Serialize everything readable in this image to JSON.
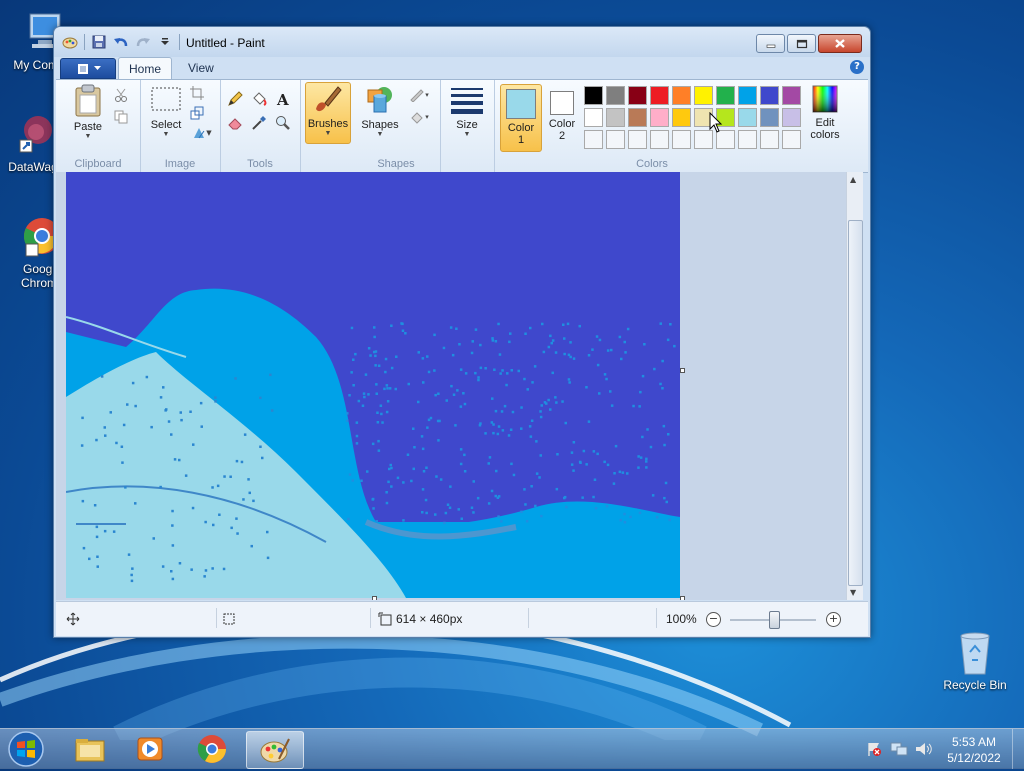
{
  "desktop": {
    "icons": [
      {
        "label": "My Comp",
        "icon": "computer-icon"
      },
      {
        "label": "DataWag",
        "icon": "shortcut-icon"
      },
      {
        "label": "Googl",
        "label2": "Chrom",
        "icon": "chrome-icon"
      },
      {
        "label": "Recycle Bin",
        "icon": "recycle-bin-icon"
      }
    ]
  },
  "window": {
    "title": "Untitled - Paint",
    "tabs": [
      {
        "label": "Home"
      },
      {
        "label": "View"
      }
    ],
    "ribbon": {
      "clipboard": {
        "label": "Clipboard",
        "paste": "Paste"
      },
      "image": {
        "label": "Image",
        "select": "Select"
      },
      "tools": {
        "label": "Tools"
      },
      "brushes": "Brushes",
      "shapes": {
        "label": "Shapes",
        "button": "Shapes"
      },
      "size": "Size",
      "color1": {
        "line1": "Color",
        "line2": "1",
        "value": "#99d9ea"
      },
      "color2": {
        "line1": "Color",
        "line2": "2",
        "value": "#ffffff"
      },
      "colors_label": "Colors",
      "edit_colors": {
        "line1": "Edit",
        "line2": "colors"
      },
      "palette_row1": [
        "#000000",
        "#7f7f7f",
        "#880015",
        "#ed1c24",
        "#ff7f27",
        "#fff200",
        "#22b14c",
        "#00a2e8",
        "#3f48cc",
        "#a349a4"
      ],
      "palette_row2": [
        "#ffffff",
        "#c3c3c3",
        "#b97a57",
        "#ffaec9",
        "#ffc90e",
        "#efe4b0",
        "#b5e61d",
        "#99d9ea",
        "#7092be",
        "#c8bfe7"
      ]
    },
    "status": {
      "dimensions": "614 × 460px",
      "zoom": "100%",
      "zoom_level": 1.0
    }
  },
  "taskbar": {
    "time": "5:53 AM",
    "date": "5/12/2022"
  }
}
